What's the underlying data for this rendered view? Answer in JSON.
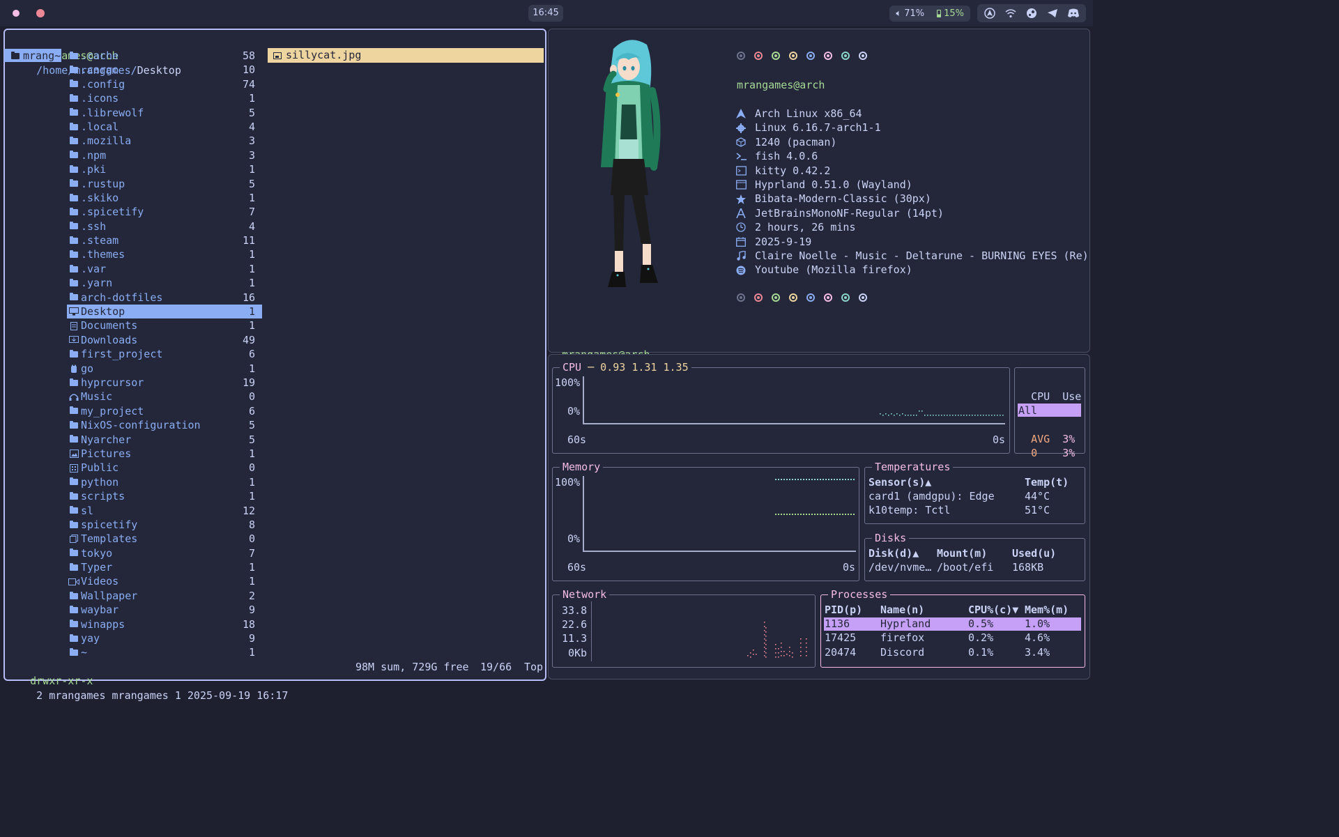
{
  "topbar": {
    "clock": "16:45",
    "volume": "71%",
    "battery": "15%",
    "icons": [
      "volume-icon",
      "battery-icon",
      "arch-icon",
      "wifi-icon",
      "steam-icon",
      "telegram-icon",
      "discord-icon"
    ]
  },
  "file_manager": {
    "header_user": "mrangames@arch",
    "header_path": "/home/mrangames/",
    "header_dir": "Desktop",
    "parent": "mrang~",
    "entries": [
      {
        "name": ".cache",
        "count": "58",
        "icon": "folder"
      },
      {
        "name": ".cargo",
        "count": "10",
        "icon": "folder"
      },
      {
        "name": ".config",
        "count": "74",
        "icon": "folder"
      },
      {
        "name": ".icons",
        "count": "1",
        "icon": "folder"
      },
      {
        "name": ".librewolf",
        "count": "5",
        "icon": "folder"
      },
      {
        "name": ".local",
        "count": "4",
        "icon": "folder"
      },
      {
        "name": ".mozilla",
        "count": "3",
        "icon": "folder"
      },
      {
        "name": ".npm",
        "count": "3",
        "icon": "folder"
      },
      {
        "name": ".pki",
        "count": "1",
        "icon": "folder"
      },
      {
        "name": ".rustup",
        "count": "5",
        "icon": "folder"
      },
      {
        "name": ".skiko",
        "count": "1",
        "icon": "folder"
      },
      {
        "name": ".spicetify",
        "count": "7",
        "icon": "folder"
      },
      {
        "name": ".ssh",
        "count": "4",
        "icon": "folder"
      },
      {
        "name": ".steam",
        "count": "11",
        "icon": "folder"
      },
      {
        "name": ".themes",
        "count": "1",
        "icon": "folder"
      },
      {
        "name": ".var",
        "count": "1",
        "icon": "folder"
      },
      {
        "name": ".yarn",
        "count": "1",
        "icon": "folder"
      },
      {
        "name": "arch-dotfiles",
        "count": "16",
        "icon": "folder"
      },
      {
        "name": "Desktop",
        "count": "1",
        "icon": "desktop",
        "selected": true
      },
      {
        "name": "Documents",
        "count": "1",
        "icon": "documents"
      },
      {
        "name": "Downloads",
        "count": "49",
        "icon": "downloads"
      },
      {
        "name": "first_project",
        "count": "6",
        "icon": "folder"
      },
      {
        "name": "go",
        "count": "1",
        "icon": "go"
      },
      {
        "name": "hyprcursor",
        "count": "19",
        "icon": "folder"
      },
      {
        "name": "Music",
        "count": "0",
        "icon": "music"
      },
      {
        "name": "my_project",
        "count": "6",
        "icon": "folder"
      },
      {
        "name": "NixOS-configuration",
        "count": "5",
        "icon": "folder"
      },
      {
        "name": "Nyarcher",
        "count": "5",
        "icon": "folder"
      },
      {
        "name": "Pictures",
        "count": "1",
        "icon": "pictures"
      },
      {
        "name": "Public",
        "count": "0",
        "icon": "public"
      },
      {
        "name": "python",
        "count": "1",
        "icon": "folder"
      },
      {
        "name": "scripts",
        "count": "1",
        "icon": "folder"
      },
      {
        "name": "sl",
        "count": "12",
        "icon": "folder"
      },
      {
        "name": "spicetify",
        "count": "8",
        "icon": "folder"
      },
      {
        "name": "Templates",
        "count": "0",
        "icon": "templates"
      },
      {
        "name": "tokyo",
        "count": "7",
        "icon": "folder"
      },
      {
        "name": "Typer",
        "count": "1",
        "icon": "folder"
      },
      {
        "name": "Videos",
        "count": "1",
        "icon": "videos"
      },
      {
        "name": "Wallpaper",
        "count": "2",
        "icon": "folder"
      },
      {
        "name": "waybar",
        "count": "9",
        "icon": "folder"
      },
      {
        "name": "winapps",
        "count": "18",
        "icon": "folder"
      },
      {
        "name": "yay",
        "count": "9",
        "icon": "folder"
      },
      {
        "name": "~",
        "count": "1",
        "icon": "folder"
      }
    ],
    "preview_file": "sillycat.jpg",
    "status_perms": "drwxr-xr-x",
    "status_info": "2 mrangames mrangames 1 2025-09-19 16:17",
    "status_summary": "98M sum, 729G free",
    "status_pos": "19/66",
    "status_scroll": "Top"
  },
  "fastfetch": {
    "title": "mrangames@arch",
    "rows": [
      {
        "icon": "arch-icon",
        "text": "Arch Linux x86_64"
      },
      {
        "icon": "gear-icon",
        "text": "Linux 6.16.7-arch1-1"
      },
      {
        "icon": "package-icon",
        "text": "1240 (pacman)"
      },
      {
        "icon": "shell-icon",
        "text": "fish 4.0.6"
      },
      {
        "icon": "terminal-icon",
        "text": "kitty 0.42.2"
      },
      {
        "icon": "window-icon",
        "text": "Hyprland 0.51.0 (Wayland)"
      },
      {
        "icon": "star-icon",
        "text": "Bibata-Modern-Classic (30px)"
      },
      {
        "icon": "font-icon",
        "text": "JetBrainsMonoNF-Regular (14pt)"
      },
      {
        "icon": "clock-icon",
        "text": "2 hours, 26 mins"
      },
      {
        "icon": "calendar-icon",
        "text": "2025-9-19"
      },
      {
        "icon": "music-icon",
        "text": "Claire Noelle - Music - Deltarune - BURNING EYES (Re)"
      },
      {
        "icon": "spotify-icon",
        "text": "Youtube (Mozilla firefox)"
      }
    ],
    "palette": [
      "#6e738d",
      "#ed8796",
      "#a6da95",
      "#eed49f",
      "#8aadf4",
      "#f5bde6",
      "#8bd5ca",
      "#cad3f5"
    ],
    "prompt_user": "mrangames@arch",
    "prompt_symbol": "⤳"
  },
  "btop": {
    "cpu": {
      "title": "CPU",
      "load": "─ 0.93 1.31 1.35",
      "y_top": "100%",
      "y_bottom": "0%",
      "x_left": "60s",
      "x_right": "0s",
      "col_cpu": "CPU",
      "col_use": "Use",
      "rows": [
        {
          "label": "All",
          "value": ""
        },
        {
          "label": "AVG",
          "value": "3%"
        },
        {
          "label": "0",
          "value": "3%"
        }
      ]
    },
    "memory": {
      "title": "Memory",
      "y_top": "100%",
      "y_bottom": "0%",
      "x_left": "60s",
      "x_right": "0s"
    },
    "temps": {
      "title": "Temperatures",
      "col_sensor": "Sensor(s)▲",
      "col_temp": "Temp(t)",
      "rows": [
        {
          "sensor": "card1 (amdgpu): Edge",
          "temp": "44°C"
        },
        {
          "sensor": "k10temp: Tctl",
          "temp": "51°C"
        }
      ]
    },
    "disks": {
      "title": "Disks",
      "col_disk": "Disk(d)▲",
      "col_mount": "Mount(m)",
      "col_used": "Used(u)",
      "rows": [
        {
          "disk": "/dev/nvme…",
          "mount": "/boot/efi",
          "used": "168KB"
        }
      ]
    },
    "network": {
      "title": "Network",
      "ticks": [
        "33.8",
        "22.6",
        "11.3",
        "0Kb"
      ]
    },
    "processes": {
      "title": "Processes",
      "col_pid": "PID(p)",
      "col_name": "Name(n)",
      "col_cpu": "CPU%(c)▼",
      "col_mem": "Mem%(m)",
      "rows": [
        {
          "pid": "1136",
          "name": "Hyprland",
          "cpu": "0.5%",
          "mem": "1.0%"
        },
        {
          "pid": "17425",
          "name": "firefox",
          "cpu": "0.2%",
          "mem": "4.6%"
        },
        {
          "pid": "20474",
          "name": "Discord",
          "cpu": "0.1%",
          "mem": "3.4%"
        }
      ]
    }
  }
}
